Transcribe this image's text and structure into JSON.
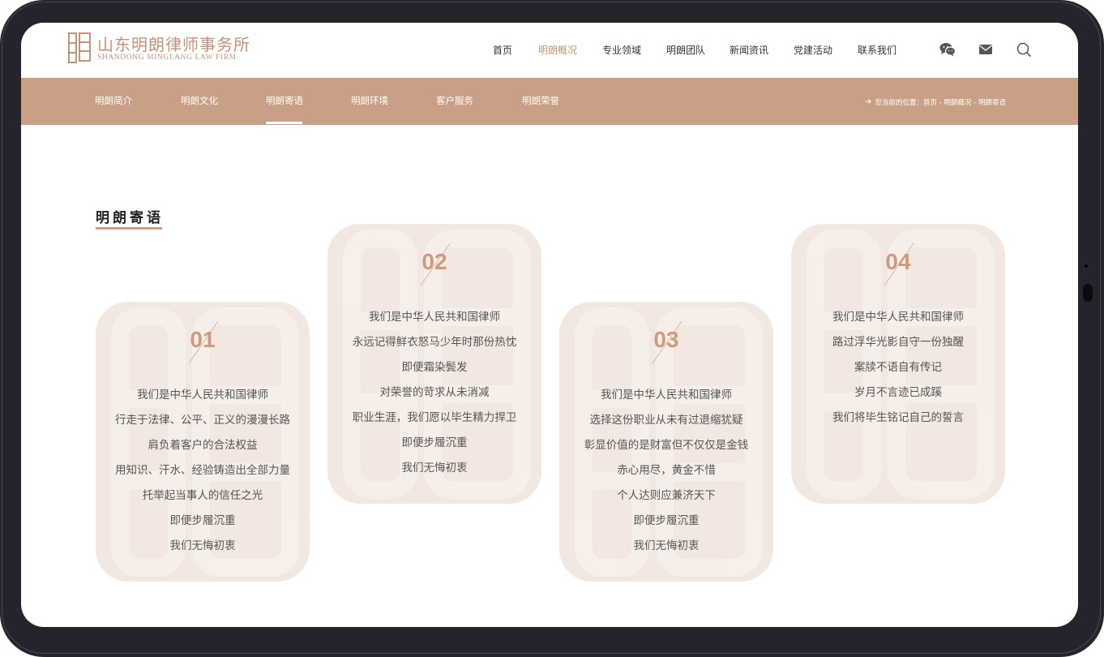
{
  "header": {
    "logo_cn": "山东明朗律师事务所",
    "logo_en": "SHANDONG MINGLANG LAW FIRM",
    "nav": [
      "首页",
      "明朗概况",
      "专业领域",
      "明朗团队",
      "新闻资讯",
      "党建活动",
      "联系我们"
    ],
    "active_nav": "明朗概况",
    "icons": [
      "wechat-icon",
      "mail-icon",
      "search-icon"
    ]
  },
  "subnav": {
    "items": [
      "明朗简介",
      "明朗文化",
      "明朗寄语",
      "明朗环境",
      "客户服务",
      "明朗荣誉"
    ],
    "active": "明朗寄语",
    "breadcrumb": "您当前的位置：首页 - 明朗概况 - 明朗寄语"
  },
  "section": {
    "title": "明朗寄语"
  },
  "cards": [
    {
      "num": "01",
      "lines": [
        "我们是中华人民共和国律师",
        "行走于法律、公平、正义的漫漫长路",
        "肩负着客户的合法权益",
        "用知识、汗水、经验铸造出全部力量",
        "托举起当事人的信任之光",
        "即便步履沉重",
        "我们无悔初衷"
      ]
    },
    {
      "num": "02",
      "lines": [
        "我们是中华人民共和国律师",
        "永远记得鲜衣怒马少年时那份热忱",
        "即便霜染鬓发",
        "对荣誉的苛求从未消减",
        "职业生涯，我们愿以毕生精力捍卫",
        "即便步履沉重",
        "我们无悔初衷"
      ]
    },
    {
      "num": "03",
      "lines": [
        "我们是中华人民共和国律师",
        "选择这份职业从未有过退缩犹疑",
        "彰显价值的是财富但不仅仅是金钱",
        "赤心用尽，黄金不惜",
        "个人达则应兼济天下",
        "即便步履沉重",
        "我们无悔初衷"
      ]
    },
    {
      "num": "04",
      "lines": [
        "我们是中华人民共和国律师",
        "路过浮华光影自守一份独醒",
        "案牍不语自有传记",
        "岁月不言迹已成蹊",
        "我们将毕生铭记自己的誓言"
      ]
    }
  ],
  "colors": {
    "accent": "#c4937b",
    "subbar": "#c99f85",
    "card_bg": "#f2e7e1",
    "frame": "#25242d"
  }
}
